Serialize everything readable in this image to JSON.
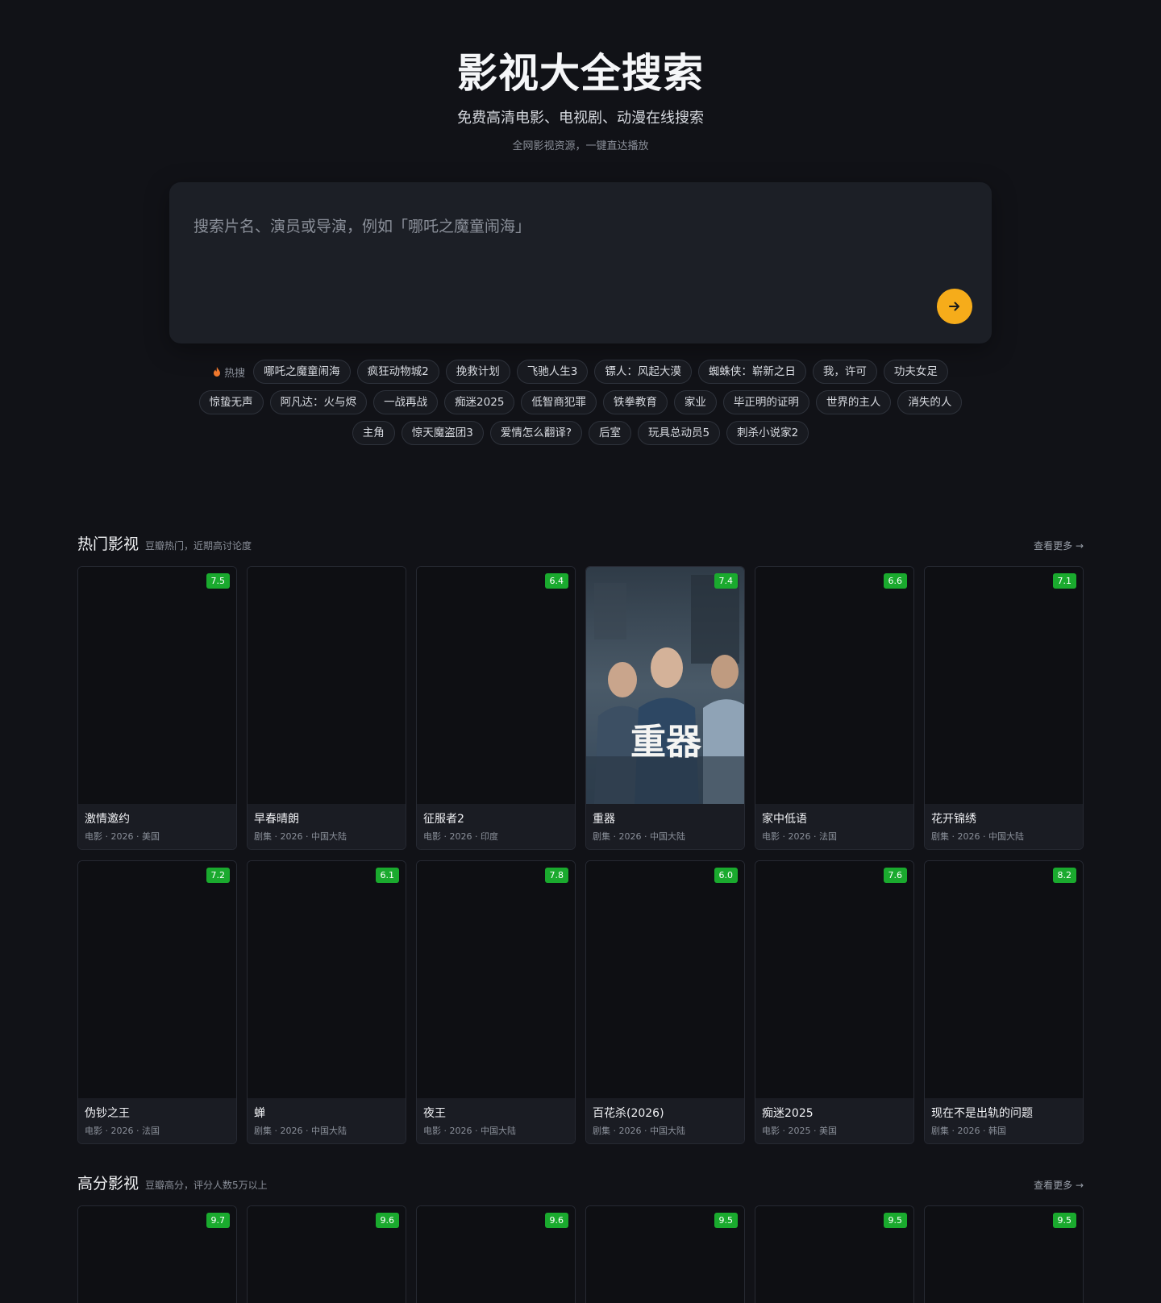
{
  "hero": {
    "title": "影视大全搜索",
    "subtitle": "免费高清电影、电视剧、动漫在线搜索",
    "note": "全网影视资源，一键直达播放"
  },
  "search": {
    "placeholder": "搜索片名、演员或导演，例如「哪吒之魔童闹海」",
    "value": ""
  },
  "hot": {
    "label": "热搜",
    "rows": [
      [
        "哪吒之魔童闹海",
        "疯狂动物城2",
        "挽救计划",
        "飞驰人生3",
        "镖人：风起大漠",
        "蜘蛛侠：崭新之日",
        "我，许可",
        "功夫女足"
      ],
      [
        "惊蛰无声",
        "阿凡达：火与烬",
        "一战再战",
        "痴迷2025",
        "低智商犯罪",
        "铁拳教育",
        "家业",
        "毕正明的证明",
        "世界的主人",
        "消失的人"
      ],
      [
        "主角",
        "惊天魔盗团3",
        "爱情怎么翻译?",
        "后室",
        "玩具总动员5",
        "刺杀小说家2"
      ]
    ]
  },
  "popular": {
    "title": "热门影视",
    "desc": "豆瓣热门，近期高讨论度",
    "more": "查看更多 →",
    "items": [
      {
        "title": "激情邀约",
        "meta": "电影 · 2026 · 美国",
        "score": "7.5"
      },
      {
        "title": "早春晴朗",
        "meta": "剧集 · 2026 · 中国大陆",
        "score": ""
      },
      {
        "title": "征服者2",
        "meta": "电影 · 2026 · 印度",
        "score": "6.4"
      },
      {
        "title": "重器",
        "meta": "剧集 · 2026 · 中国大陆",
        "score": "7.4",
        "poster_text": "重器"
      },
      {
        "title": "家中低语",
        "meta": "电影 · 2026 · 法国",
        "score": "6.6"
      },
      {
        "title": "花开锦绣",
        "meta": "剧集 · 2026 · 中国大陆",
        "score": "7.1"
      },
      {
        "title": "伪钞之王",
        "meta": "电影 · 2026 · 法国",
        "score": "7.2"
      },
      {
        "title": "蝉",
        "meta": "剧集 · 2026 · 中国大陆",
        "score": "6.1"
      },
      {
        "title": "夜王",
        "meta": "电影 · 2026 · 中国大陆",
        "score": "7.8"
      },
      {
        "title": "百花杀(2026)",
        "meta": "剧集 · 2026 · 中国大陆",
        "score": "6.0"
      },
      {
        "title": "痴迷2025",
        "meta": "电影 · 2025 · 美国",
        "score": "7.6"
      },
      {
        "title": "现在不是出轨的问题",
        "meta": "剧集 · 2026 · 韩国",
        "score": "8.2"
      }
    ]
  },
  "toprated": {
    "title": "高分影视",
    "desc": "豆瓣高分，评分人数5万以上",
    "more": "查看更多 →",
    "scores": [
      "9.7",
      "9.6",
      "9.6",
      "9.5",
      "9.5",
      "9.5"
    ]
  },
  "colors": {
    "background": "#111217",
    "accent": "#f6ac1a",
    "score_badge": "#1aaa2e",
    "hot_icon": "#f0782d"
  },
  "icons": {
    "hot": "flame-icon",
    "submit": "arrow-right-icon"
  }
}
